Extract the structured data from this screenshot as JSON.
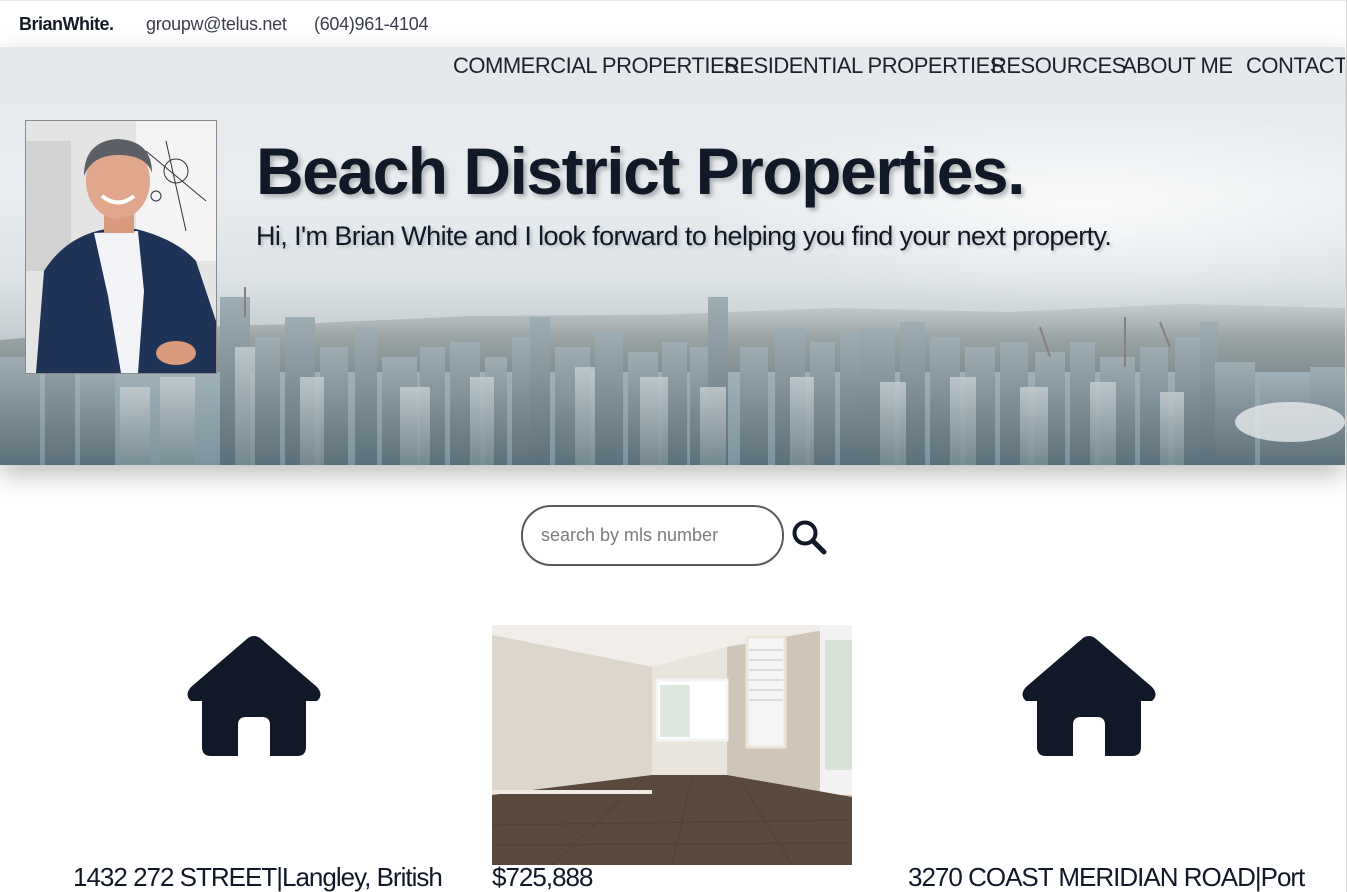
{
  "header": {
    "brand": "BrianWhite.",
    "email": "groupw@telus.net",
    "phone": "(604)961-4104"
  },
  "nav": {
    "items": [
      {
        "label": "COMMERCIAL PROPERTIES"
      },
      {
        "label": "RESIDENTIAL PROPERTIES"
      },
      {
        "label": "RESOURCES"
      },
      {
        "label": "ABOUT ME"
      },
      {
        "label": "CONTACT"
      }
    ]
  },
  "hero": {
    "title": "Beach District Properties.",
    "subtitle": "Hi, I'm Brian White and I look forward to helping you find your next property."
  },
  "search": {
    "placeholder": "search by mls number",
    "icon": "search-icon"
  },
  "listings": [
    {
      "icon": "house-icon",
      "text": "1432 272 STREET|Langley, British"
    },
    {
      "icon": "listing-photo",
      "text": "$725,888"
    },
    {
      "icon": "house-icon",
      "text": "3270 COAST MERIDIAN ROAD|Port"
    }
  ],
  "colors": {
    "text": "#141a26",
    "icon": "#111827",
    "accent_border": "#5a5a5a"
  }
}
